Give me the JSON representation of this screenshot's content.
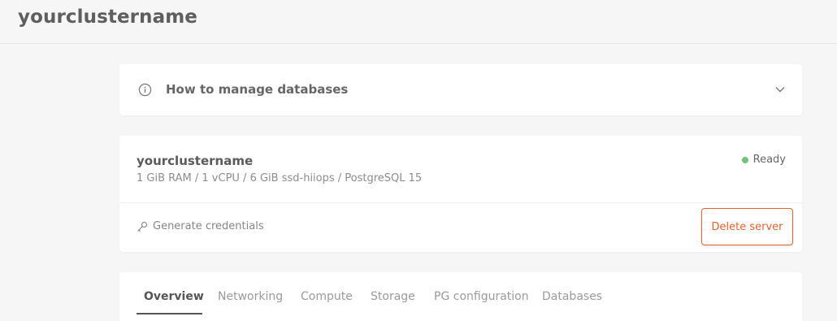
{
  "header": {
    "title": "yourclustername"
  },
  "info": {
    "title": "How to manage databases",
    "icon": "info-circle-icon",
    "toggle_icon": "chevron-down-icon"
  },
  "cluster": {
    "name": "yourclustername",
    "specs": "1 GiB RAM / 1 vCPU / 6 GiB ssd-hiiops / PostgreSQL 15",
    "status": "Ready",
    "status_color": "#6fc47b",
    "generate_label": "Generate credentials",
    "generate_icon": "key-icon",
    "delete_label": "Delete server",
    "delete_color": "#e2632e"
  },
  "tabs": [
    {
      "label": "Overview",
      "active": true
    },
    {
      "label": "Networking",
      "active": false
    },
    {
      "label": "Compute",
      "active": false
    },
    {
      "label": "Storage",
      "active": false
    },
    {
      "label": "PG configuration",
      "active": false
    },
    {
      "label": "Databases",
      "active": false
    }
  ]
}
